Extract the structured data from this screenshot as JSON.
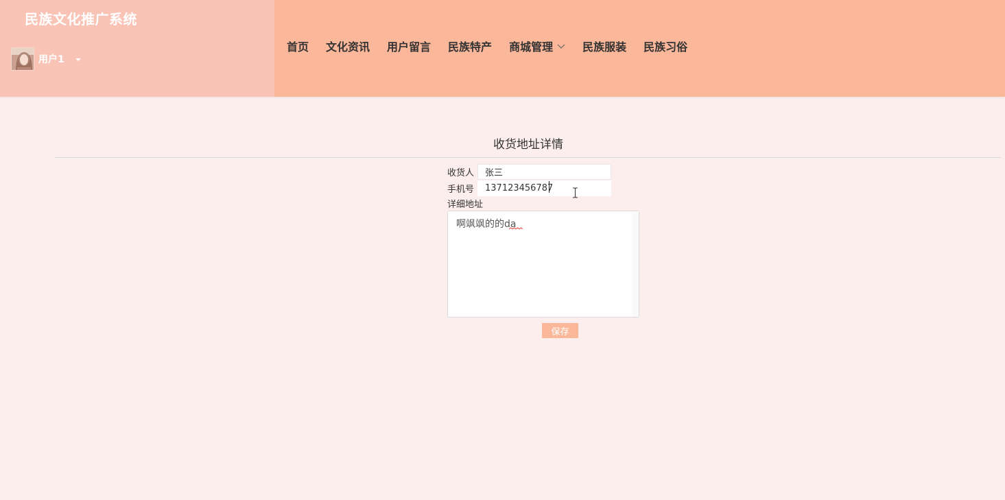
{
  "app": {
    "title": "民族文化推广系统",
    "user_name": "用户1"
  },
  "nav": {
    "items": [
      {
        "label": "首页"
      },
      {
        "label": "文化资讯"
      },
      {
        "label": "用户留言"
      },
      {
        "label": "民族特产"
      },
      {
        "label": "商城管理"
      },
      {
        "label": "民族服装"
      },
      {
        "label": "民族习俗"
      }
    ]
  },
  "form": {
    "title": "收货地址详情",
    "consignee_label": "收货人",
    "consignee_value": "张三",
    "phone_label": "手机号",
    "phone_value": "137123456787",
    "address_label": "详细地址",
    "address_value": "啊飒飒的的da",
    "save_label": "保存"
  },
  "colors": {
    "header_bg": "#fbb799",
    "brand_bg": "#f9c3b6",
    "page_bg": "#fdeeee",
    "button_bg": "#fbb799"
  },
  "icons": {
    "avatar": "user-avatar",
    "dropdown": "caret-down-icon",
    "submenu": "chevron-down-icon"
  }
}
